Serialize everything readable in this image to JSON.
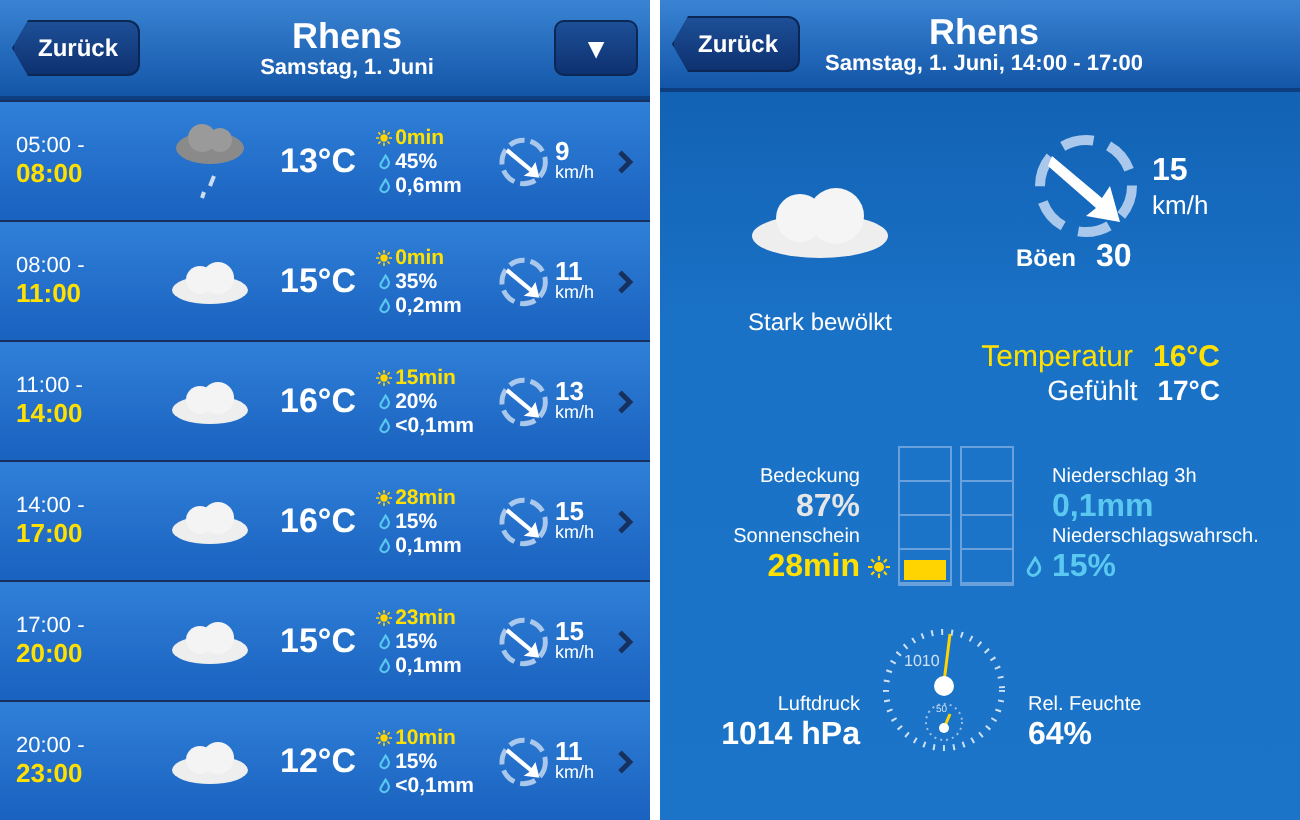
{
  "list_view": {
    "back": "Zurück",
    "title": "Rhens",
    "subtitle": "Samstag, 1. Juni",
    "menu_button": "▼",
    "rows": [
      {
        "from": "05:00 -",
        "to": "08:00",
        "kind": "rain",
        "temp": "13°C",
        "sun": "0min",
        "chance": "45%",
        "amount": "0,6mm",
        "wind": "9",
        "unit": "km/h"
      },
      {
        "from": "08:00 -",
        "to": "11:00",
        "kind": "cloud",
        "temp": "15°C",
        "sun": "0min",
        "chance": "35%",
        "amount": "0,2mm",
        "wind": "11",
        "unit": "km/h"
      },
      {
        "from": "11:00 -",
        "to": "14:00",
        "kind": "cloud",
        "temp": "16°C",
        "sun": "15min",
        "chance": "20%",
        "amount": "<0,1mm",
        "wind": "13",
        "unit": "km/h"
      },
      {
        "from": "14:00 -",
        "to": "17:00",
        "kind": "cloud",
        "temp": "16°C",
        "sun": "28min",
        "chance": "15%",
        "amount": "0,1mm",
        "wind": "15",
        "unit": "km/h"
      },
      {
        "from": "17:00 -",
        "to": "20:00",
        "kind": "cloud",
        "temp": "15°C",
        "sun": "23min",
        "chance": "15%",
        "amount": "0,1mm",
        "wind": "15",
        "unit": "km/h"
      },
      {
        "from": "20:00 -",
        "to": "23:00",
        "kind": "cloud",
        "temp": "12°C",
        "sun": "10min",
        "chance": "15%",
        "amount": "<0,1mm",
        "wind": "11",
        "unit": "km/h"
      }
    ]
  },
  "detail_view": {
    "back": "Zurück",
    "title": "Rhens",
    "subtitle": "Samstag, 1. Juni, 14:00 - 17:00",
    "condition": "Stark bewölkt",
    "wind_speed": "15",
    "wind_unit": "km/h",
    "gusts_label": "Böen",
    "gusts": "30",
    "temp_label": "Temperatur",
    "temp": "16°C",
    "feels_label": "Gefühlt",
    "feels": "17°C",
    "cover_label": "Bedeckung",
    "cover": "87%",
    "sun_label": "Sonnenschein",
    "sun": "28min",
    "sun_meter": {
      "level": 0.15
    },
    "precip_label": "Niederschlag 3h",
    "precip": "0,1mm",
    "chance_label": "Niederschlagswahrsch.",
    "chance": "15%",
    "pressure_label": "Luftdruck",
    "pressure": "1014 hPa",
    "gauge_major": "1010",
    "gauge_minor": "50",
    "humidity_label": "Rel. Feuchte",
    "humidity": "64%"
  }
}
